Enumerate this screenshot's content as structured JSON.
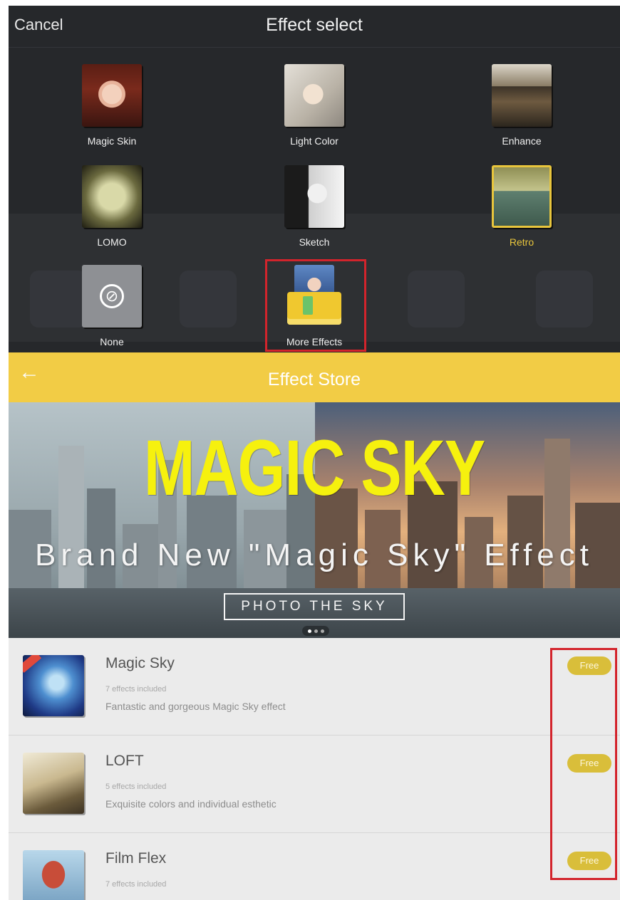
{
  "effect_select": {
    "cancel_label": "Cancel",
    "title": "Effect select",
    "effects": [
      {
        "label": "Magic Skin",
        "icon": "portrait-thumbnail"
      },
      {
        "label": "Light Color",
        "icon": "portrait-thumbnail"
      },
      {
        "label": "Enhance",
        "icon": "street-photo-thumbnail"
      },
      {
        "label": "LOMO",
        "icon": "city-photo-thumbnail"
      },
      {
        "label": "Sketch",
        "icon": "portrait-thumbnail"
      },
      {
        "label": "Retro",
        "icon": "retro-photo-thumbnail",
        "selected": true
      },
      {
        "label": "None",
        "icon": "no-effect-icon"
      },
      {
        "label": "More Effects",
        "icon": "effects-box-icon"
      }
    ]
  },
  "effect_store": {
    "back_icon": "arrow-left-icon",
    "title": "Effect Store",
    "banner": {
      "title": "MAGIC SKY",
      "subtitle": "Brand New \"Magic Sky\" Effect",
      "cta": "PHOTO THE SKY",
      "page_index": 1,
      "page_count": 3
    },
    "items": [
      {
        "name": "Magic Sky",
        "count": "7 effects included",
        "description": "Fantastic and gorgeous Magic Sky effect",
        "button": "Free"
      },
      {
        "name": "LOFT",
        "count": "5 effects included",
        "description": "Exquisite colors and individual esthetic",
        "button": "Free"
      },
      {
        "name": "Film Flex",
        "count": "7 effects included",
        "description": "",
        "button": "Free"
      }
    ]
  },
  "colors": {
    "dark_bg": "#26282b",
    "store_yellow": "#f2cc45",
    "accent_selected": "#e8c53c",
    "free_button": "#d9be3a",
    "highlight_box": "#d3242c",
    "banner_title": "#f6f10e"
  }
}
